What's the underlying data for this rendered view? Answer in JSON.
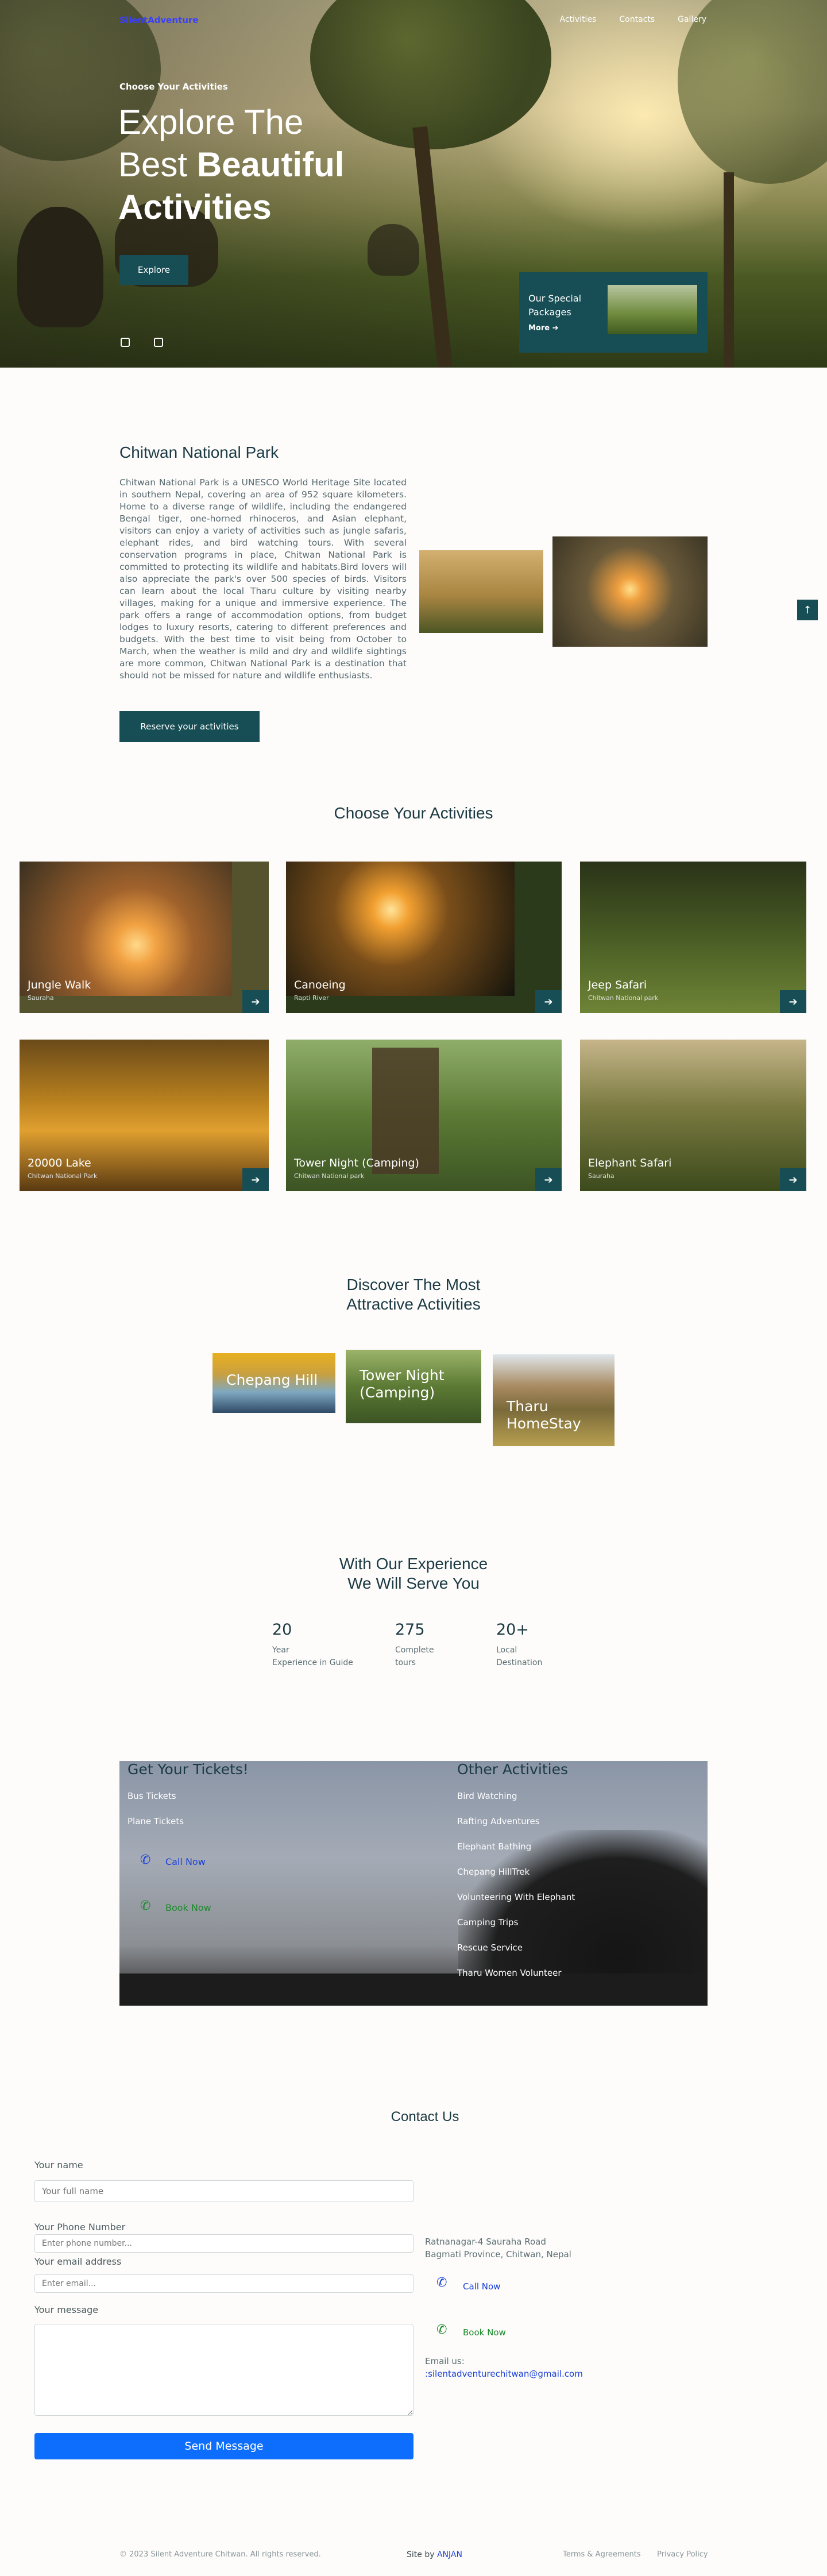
{
  "brand": "SilentAdventure",
  "nav": [
    "Activities",
    "Contacts",
    "Gallery"
  ],
  "hero": {
    "eyebrow": "Choose Your Activities",
    "title_line1": "Explore The",
    "title_line2_plain": "Best ",
    "title_line2_bold": "Beautiful",
    "title_line3": "Activities",
    "explore_label": "Explore",
    "special_title": "Our Special Packages",
    "special_more": "More"
  },
  "about": {
    "title": "Chitwan National Park",
    "text": "Chitwan National Park is a UNESCO World Heritage Site located in southern Nepal, covering an area of 952 square kilometers. Home to a diverse range of wildlife, including the endangered Bengal tiger, one-horned rhinoceros, and Asian elephant, visitors can enjoy a variety of activities such as jungle safaris, elephant rides, and bird watching tours. With several conservation programs in place, Chitwan National Park is committed to protecting its wildlife and habitats.Bird lovers will also appreciate the park's over 500 species of birds. Visitors can learn about the local Tharu culture by visiting nearby villages, making for a unique and immersive experience. The park offers a range of accommodation options, from budget lodges to luxury resorts, catering to different preferences and budgets. With the best time to visit being from October to March, when the weather is mild and dry and wildlife sightings are more common, Chitwan National Park is a destination that should not be missed for nature and wildlife enthusiasts.",
    "reserve_label": "Reserve your activities"
  },
  "activities": {
    "title": "Choose Your Activities",
    "cards": [
      {
        "name": "Jungle Walk",
        "sub": "Sauraha"
      },
      {
        "name": "Canoeing",
        "sub": "Rapti River"
      },
      {
        "name": "Jeep Safari",
        "sub": "Chitwan National park"
      },
      {
        "name": "20000 Lake",
        "sub": "Chitwan National Park"
      },
      {
        "name": "Tower Night (Camping)",
        "sub": "Chitwan National park"
      },
      {
        "name": "Elephant Safari",
        "sub": "Sauraha"
      }
    ]
  },
  "discover": {
    "title_line1": "Discover The Most",
    "title_line2": "Attractive Activities",
    "items": [
      "Chepang Hill",
      "Tower Night (Camping)",
      "Tharu HomeStay"
    ]
  },
  "experience": {
    "title_line1": "With Our Experience",
    "title_line2": "We Will Serve You",
    "stats": [
      {
        "num": "20",
        "l1": "Year",
        "l2": "Experience in Guide"
      },
      {
        "num": "275",
        "l1": "Complete",
        "l2": "tours"
      },
      {
        "num": "20+",
        "l1": "Local",
        "l2": "Destination"
      }
    ]
  },
  "tickets": {
    "title": "Get Your Tickets!",
    "items": [
      "Bus Tickets",
      "Plane Tickets"
    ],
    "call": "Call Now",
    "book": "Book Now",
    "other_title": "Other Activities",
    "other_items": [
      "Bird Watching",
      "Rafting Adventures",
      "Elephant Bathing",
      "Chepang HillTrek",
      "Volunteering With Elephant",
      "Camping Trips",
      "Rescue Service",
      "Tharu Women Volunteer"
    ]
  },
  "contact": {
    "title": "Contact Us",
    "name_label": "Your name",
    "name_placeholder": "Your full name",
    "phone_label": "Your Phone Number",
    "phone_placeholder": "Enter phone number...",
    "email_label": "Your email address",
    "email_placeholder": "Enter email...",
    "message_label": "Your message",
    "send_label": "Send Message",
    "addr_line1": "Ratnanagar-4 Sauraha Road",
    "addr_line2": "Bagmati Province, Chitwan, Nepal",
    "call": "Call Now",
    "book": "Book Now",
    "email_title": "Email us:",
    "email": "silentadventurechitwan@gmail.com"
  },
  "footer": {
    "copy": "© 2023 Silent Adventure Chitwan. All rights reserved.",
    "site_by": "Site by ",
    "author": "ANJAN",
    "terms": "Terms & Agreements",
    "privacy": "Privacy Policy"
  },
  "colors": {
    "primary": "#174d54",
    "brand": "#3a3fff",
    "send": "#0d6efd"
  }
}
